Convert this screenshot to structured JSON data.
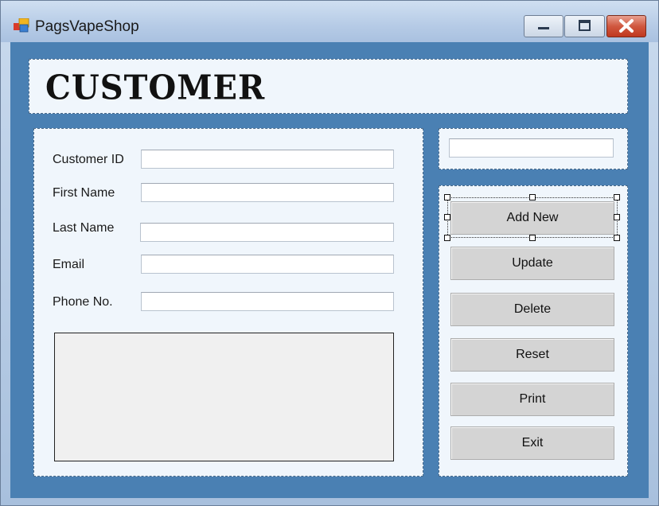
{
  "window": {
    "title": "PagsVapeShop"
  },
  "controls": {
    "minimize": "minimize",
    "maximize": "maximize",
    "close": "close"
  },
  "header": {
    "heading": "CUSTOMER"
  },
  "form": {
    "fields": [
      {
        "label": "Customer ID",
        "value": ""
      },
      {
        "label": "First Name",
        "value": ""
      },
      {
        "label": "Last Name",
        "value": ""
      },
      {
        "label": "Email",
        "value": ""
      },
      {
        "label": "Phone No.",
        "value": ""
      }
    ]
  },
  "side": {
    "top_field_value": ""
  },
  "buttons": {
    "add_new": "Add New",
    "update": "Update",
    "delete": "Delete",
    "reset": "Reset",
    "print": "Print",
    "exit": "Exit"
  },
  "colors": {
    "client_bg": "#4a80b3",
    "panel_bg": "#f0f6fc",
    "button_bg": "#d4d4d4",
    "close_red": "#c8452c"
  }
}
